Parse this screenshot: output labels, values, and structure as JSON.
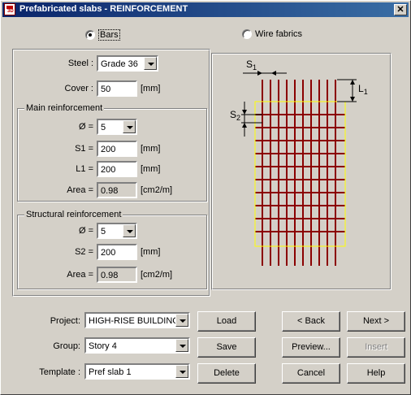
{
  "window": {
    "title": "Prefabricated slabs - REINFORCEMENT",
    "close_label": "✕"
  },
  "mode": {
    "bars_label": "Bars",
    "wire_label": "Wire fabrics",
    "selected": "bars"
  },
  "steel": {
    "label": "Steel :",
    "value": "Grade 36"
  },
  "cover": {
    "label": "Cover :",
    "value": "50",
    "unit": "[mm]"
  },
  "main": {
    "title": "Main reinforcement",
    "dia_label": "Ø  =",
    "dia_value": "5",
    "s1_label": "S1 =",
    "s1_value": "200",
    "s1_unit": "[mm]",
    "l1_label": "L1 =",
    "l1_value": "200",
    "l1_unit": "[mm]",
    "area_label": "Area =",
    "area_value": "0.98",
    "area_unit": "[cm2/m]"
  },
  "structural": {
    "title": "Structural reinforcement",
    "dia_label": "Ø  =",
    "dia_value": "5",
    "s2_label": "S2 =",
    "s2_value": "200",
    "s2_unit": "[mm]",
    "area_label": "Area =",
    "area_value": "0.98",
    "area_unit": "[cm2/m]"
  },
  "diagram": {
    "s1_main": "S",
    "s1_sub": "1",
    "s2_main": "S",
    "s2_sub": "2",
    "l1_main": "L",
    "l1_sub": "1",
    "bar_color": "#8b0000",
    "outline_color": "#ffff00"
  },
  "project": {
    "label": "Project:",
    "value": "HIGH-RISE BUILDING"
  },
  "group": {
    "label": "Group:",
    "value": "Story 4"
  },
  "template": {
    "label": "Template :",
    "value": "Pref slab 1"
  },
  "buttons": {
    "load": "Load",
    "save": "Save",
    "delete": "Delete",
    "back": "< Back",
    "next": "Next >",
    "preview": "Preview...",
    "insert": "Insert",
    "cancel": "Cancel",
    "help": "Help"
  }
}
